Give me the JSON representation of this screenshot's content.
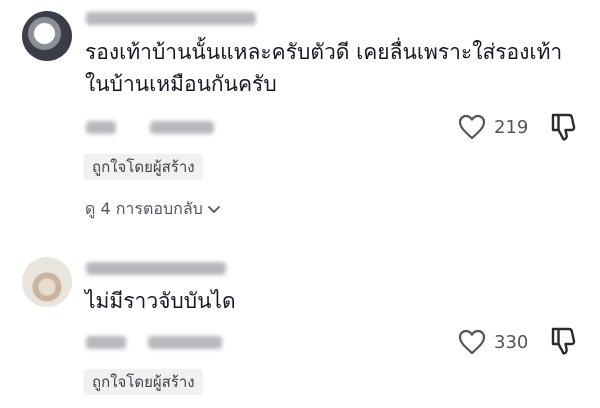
{
  "comments": [
    {
      "text": "รองเท้าบ้านนั้นแหละครับตัวดี เคยลื่นเพราะใส่รองเท้า\nในบ้านเหมือนกันครับ",
      "likes": "219",
      "creator_liked": "ถูกใจโดยผู้สร้าง",
      "view_replies": "ดู 4 การตอบกลับ"
    },
    {
      "text": "ไม่มีราวจับบันได",
      "likes": "330",
      "creator_liked": "ถูกใจโดยผู้สร้าง"
    }
  ],
  "icons": [
    "heart-outline-icon",
    "thumbs-down-icon",
    "chevron-down-icon"
  ]
}
